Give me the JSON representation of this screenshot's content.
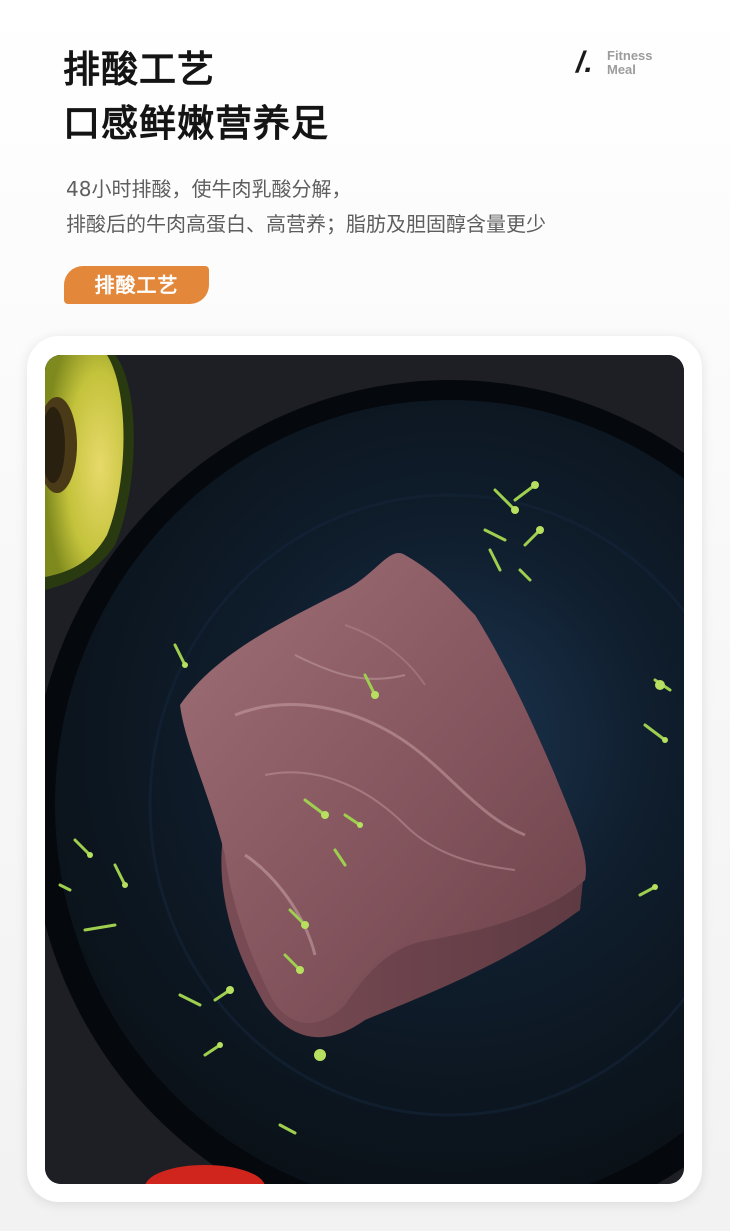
{
  "header": {
    "title_line_1": "排酸工艺",
    "title_line_2": "口感鲜嫩营养足"
  },
  "brand": {
    "slash": "/.",
    "word_1": "Fitness",
    "word_2": "Meal"
  },
  "description": {
    "line_1": "48小时排酸，使牛肉乳酸分解，",
    "line_2": "排酸后的牛肉高蛋白、高营养；脂肪及胆固醇含量更少"
  },
  "tag": {
    "label": "排酸工艺"
  },
  "colors": {
    "accent": "#e3883a",
    "title": "#141414",
    "body_text": "#5e5e5e",
    "brand_text": "#9c9c9c"
  },
  "photo": {
    "subject_icon": "beef-steak-on-plate"
  }
}
